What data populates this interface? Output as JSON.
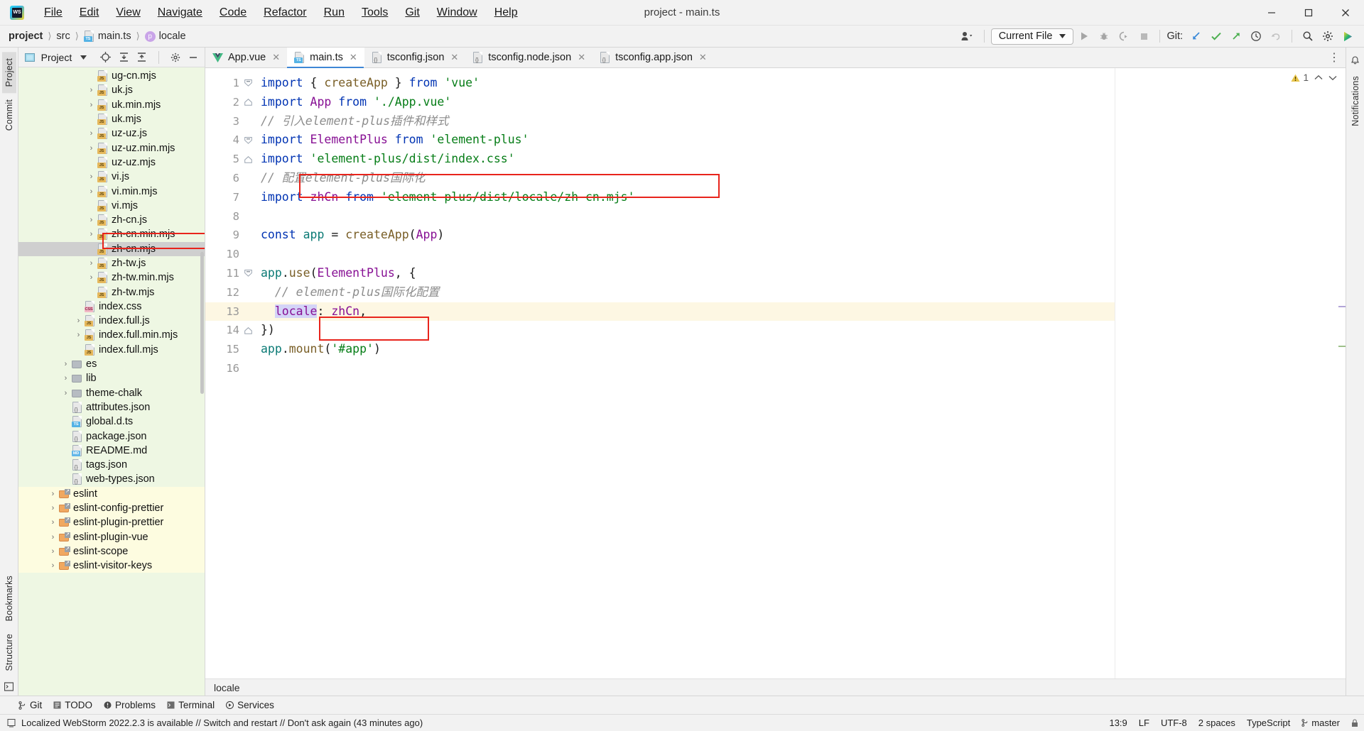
{
  "window": {
    "title": "project - main.ts",
    "app_icon": "webstorm-logo",
    "minimize": "─",
    "maximize": "☐",
    "close": "✕"
  },
  "menubar": [
    {
      "label": "File"
    },
    {
      "label": "Edit"
    },
    {
      "label": "View"
    },
    {
      "label": "Navigate"
    },
    {
      "label": "Code"
    },
    {
      "label": "Refactor"
    },
    {
      "label": "Run"
    },
    {
      "label": "Tools"
    },
    {
      "label": "Git"
    },
    {
      "label": "Window"
    },
    {
      "label": "Help"
    }
  ],
  "navbar": {
    "breadcrumbs": [
      {
        "label": "project",
        "icon": ""
      },
      {
        "label": "src",
        "icon": ""
      },
      {
        "label": "main.ts",
        "icon": "ts-file-icon"
      },
      {
        "label": "locale",
        "icon": "property-icon"
      }
    ],
    "separator": "〉",
    "run_config": "Current File",
    "run_config_caret": "▼",
    "git_label": "Git:",
    "icons": [
      "avatar-dropdown-icon",
      "run-icon",
      "debug-icon",
      "coverage-icon",
      "stop-icon",
      "update-project-icon",
      "commit-icon",
      "push-icon",
      "history-icon",
      "rollback-icon",
      "search-everywhere-icon",
      "settings-icon",
      "ide-assistant-icon"
    ]
  },
  "left_rail": {
    "tabs": [
      {
        "label": "Project",
        "active": true
      },
      {
        "label": "Commit",
        "active": false
      },
      {
        "label": "Bookmarks",
        "active": false
      },
      {
        "label": "Structure",
        "active": false
      }
    ]
  },
  "right_rail": {
    "tabs": [
      {
        "label": "Notifications",
        "active": false
      }
    ]
  },
  "project_panel": {
    "title": "Project",
    "title_caret": "▼",
    "toolbar_icons": [
      "locate-icon",
      "expand-all-icon",
      "collapse-all-icon",
      "settings-icon",
      "hide-icon"
    ],
    "tree": [
      {
        "name": "ug-cn.mjs",
        "icon": "js-file-icon",
        "indent": 5,
        "arrow": "",
        "sel": false,
        "bg": "green"
      },
      {
        "name": "uk.js",
        "icon": "js-file-icon",
        "indent": 5,
        "arrow": "›",
        "sel": false,
        "bg": "green"
      },
      {
        "name": "uk.min.mjs",
        "icon": "js-file-icon",
        "indent": 5,
        "arrow": "›",
        "sel": false,
        "bg": "green"
      },
      {
        "name": "uk.mjs",
        "icon": "js-file-icon",
        "indent": 5,
        "arrow": "",
        "sel": false,
        "bg": "green"
      },
      {
        "name": "uz-uz.js",
        "icon": "js-file-icon",
        "indent": 5,
        "arrow": "›",
        "sel": false,
        "bg": "green"
      },
      {
        "name": "uz-uz.min.mjs",
        "icon": "js-file-icon",
        "indent": 5,
        "arrow": "›",
        "sel": false,
        "bg": "green"
      },
      {
        "name": "uz-uz.mjs",
        "icon": "js-file-icon",
        "indent": 5,
        "arrow": "",
        "sel": false,
        "bg": "green"
      },
      {
        "name": "vi.js",
        "icon": "js-file-icon",
        "indent": 5,
        "arrow": "›",
        "sel": false,
        "bg": "green"
      },
      {
        "name": "vi.min.mjs",
        "icon": "js-file-icon",
        "indent": 5,
        "arrow": "›",
        "sel": false,
        "bg": "green"
      },
      {
        "name": "vi.mjs",
        "icon": "js-file-icon",
        "indent": 5,
        "arrow": "",
        "sel": false,
        "bg": "green"
      },
      {
        "name": "zh-cn.js",
        "icon": "js-file-icon",
        "indent": 5,
        "arrow": "›",
        "sel": false,
        "bg": "green"
      },
      {
        "name": "zh-cn.min.mjs",
        "icon": "js-file-icon",
        "indent": 5,
        "arrow": "›",
        "sel": false,
        "bg": "green"
      },
      {
        "name": "zh-cn.mjs",
        "icon": "js-file-icon",
        "indent": 5,
        "arrow": "",
        "sel": true,
        "bg": "green"
      },
      {
        "name": "zh-tw.js",
        "icon": "js-file-icon",
        "indent": 5,
        "arrow": "›",
        "sel": false,
        "bg": "green"
      },
      {
        "name": "zh-tw.min.mjs",
        "icon": "js-file-icon",
        "indent": 5,
        "arrow": "›",
        "sel": false,
        "bg": "green"
      },
      {
        "name": "zh-tw.mjs",
        "icon": "js-file-icon",
        "indent": 5,
        "arrow": "",
        "sel": false,
        "bg": "green"
      },
      {
        "name": "index.css",
        "icon": "css-file-icon",
        "indent": 4,
        "arrow": "",
        "sel": false,
        "bg": "green"
      },
      {
        "name": "index.full.js",
        "icon": "js-file-icon",
        "indent": 4,
        "arrow": "›",
        "sel": false,
        "bg": "green"
      },
      {
        "name": "index.full.min.mjs",
        "icon": "js-file-icon",
        "indent": 4,
        "arrow": "›",
        "sel": false,
        "bg": "green"
      },
      {
        "name": "index.full.mjs",
        "icon": "js-file-icon",
        "indent": 4,
        "arrow": "",
        "sel": false,
        "bg": "green"
      },
      {
        "name": "es",
        "icon": "folder-icon",
        "indent": 3,
        "arrow": "›",
        "sel": false,
        "bg": "green"
      },
      {
        "name": "lib",
        "icon": "folder-icon",
        "indent": 3,
        "arrow": "›",
        "sel": false,
        "bg": "green"
      },
      {
        "name": "theme-chalk",
        "icon": "folder-icon",
        "indent": 3,
        "arrow": "›",
        "sel": false,
        "bg": "green"
      },
      {
        "name": "attributes.json",
        "icon": "json-file-icon",
        "indent": 3,
        "arrow": "",
        "sel": false,
        "bg": "green"
      },
      {
        "name": "global.d.ts",
        "icon": "ts-file-icon",
        "indent": 3,
        "arrow": "",
        "sel": false,
        "bg": "green"
      },
      {
        "name": "package.json",
        "icon": "json-file-icon",
        "indent": 3,
        "arrow": "",
        "sel": false,
        "bg": "green"
      },
      {
        "name": "README.md",
        "icon": "md-file-icon",
        "indent": 3,
        "arrow": "",
        "sel": false,
        "bg": "green"
      },
      {
        "name": "tags.json",
        "icon": "json-file-icon",
        "indent": 3,
        "arrow": "",
        "sel": false,
        "bg": "green"
      },
      {
        "name": "web-types.json",
        "icon": "json-file-icon",
        "indent": 3,
        "arrow": "",
        "sel": false,
        "bg": "green"
      },
      {
        "name": "eslint",
        "icon": "linked-folder-icon",
        "indent": 2,
        "arrow": "›",
        "sel": false,
        "bg": "yellow"
      },
      {
        "name": "eslint-config-prettier",
        "icon": "linked-folder-icon",
        "indent": 2,
        "arrow": "›",
        "sel": false,
        "bg": "yellow"
      },
      {
        "name": "eslint-plugin-prettier",
        "icon": "linked-folder-icon",
        "indent": 2,
        "arrow": "›",
        "sel": false,
        "bg": "yellow"
      },
      {
        "name": "eslint-plugin-vue",
        "icon": "linked-folder-icon",
        "indent": 2,
        "arrow": "›",
        "sel": false,
        "bg": "yellow"
      },
      {
        "name": "eslint-scope",
        "icon": "linked-folder-icon",
        "indent": 2,
        "arrow": "›",
        "sel": false,
        "bg": "yellow"
      },
      {
        "name": "eslint-visitor-keys",
        "icon": "linked-folder-icon",
        "indent": 2,
        "arrow": "›",
        "sel": false,
        "bg": "yellow"
      }
    ]
  },
  "editor": {
    "tabs": [
      {
        "label": "App.vue",
        "icon": "vue-file-icon",
        "active": false,
        "close": "✕"
      },
      {
        "label": "main.ts",
        "icon": "ts-file-icon",
        "active": true,
        "close": "✕"
      },
      {
        "label": "tsconfig.json",
        "icon": "json-file-icon",
        "active": false,
        "close": "✕"
      },
      {
        "label": "tsconfig.node.json",
        "icon": "json-file-icon",
        "active": false,
        "close": "✕"
      },
      {
        "label": "tsconfig.app.json",
        "icon": "json-file-icon",
        "active": false,
        "close": "✕"
      }
    ],
    "tabbar_more": "⋮",
    "inspection": {
      "warning_count": "1",
      "up": "⌃",
      "down": "⌄"
    },
    "breadcrumb_bottom": "locale",
    "line_numbers": [
      "1",
      "2",
      "3",
      "4",
      "5",
      "6",
      "7",
      "8",
      "9",
      "10",
      "11",
      "12",
      "13",
      "14",
      "15",
      "16"
    ],
    "lines": [
      {
        "n": 1,
        "fold": "minus",
        "text": "import { createApp } from 'vue'"
      },
      {
        "n": 2,
        "fold": "end",
        "text": "import App from './App.vue'"
      },
      {
        "n": 3,
        "fold": "",
        "text": "// 引入element-plus插件和样式"
      },
      {
        "n": 4,
        "fold": "minus",
        "text": "import ElementPlus from 'element-plus'"
      },
      {
        "n": 5,
        "fold": "end",
        "text": "import 'element-plus/dist/index.css'"
      },
      {
        "n": 6,
        "fold": "",
        "text": "// 配置element-plus国际化"
      },
      {
        "n": 7,
        "fold": "",
        "text": "import zhCn from 'element-plus/dist/locale/zh-cn.mjs'"
      },
      {
        "n": 8,
        "fold": "",
        "text": ""
      },
      {
        "n": 9,
        "fold": "",
        "text": "const app = createApp(App)"
      },
      {
        "n": 10,
        "fold": "",
        "text": ""
      },
      {
        "n": 11,
        "fold": "minus",
        "text": "app.use(ElementPlus, {"
      },
      {
        "n": 12,
        "fold": "",
        "text": "  // element-plus国际化配置"
      },
      {
        "n": 13,
        "fold": "",
        "text": "  locale: zhCn,"
      },
      {
        "n": 14,
        "fold": "end",
        "text": "})"
      },
      {
        "n": 15,
        "fold": "",
        "text": "app.mount('#app')"
      },
      {
        "n": 16,
        "fold": "",
        "text": ""
      }
    ]
  },
  "annotations": {
    "color": "#e8241c",
    "boxes": [
      "tree-zh-cn-mjs-highlight",
      "code-line-7-highlight",
      "code-line-13-locale-highlight"
    ]
  },
  "tool_windows": [
    {
      "label": "Git",
      "icon": "git-branch-icon"
    },
    {
      "label": "TODO",
      "icon": "todo-icon"
    },
    {
      "label": "Problems",
      "icon": "problems-icon"
    },
    {
      "label": "Terminal",
      "icon": "terminal-icon"
    },
    {
      "label": "Services",
      "icon": "services-icon"
    }
  ],
  "statusbar": {
    "message_icon": "notification-icon",
    "message": "Localized WebStorm 2022.2.3 is available // Switch and restart // Don't ask again (43 minutes ago)",
    "caret": "13:9",
    "line_sep": "LF",
    "encoding": "UTF-8",
    "indent": "2 spaces",
    "language": "TypeScript",
    "branch": "master",
    "branch_icon": "git-branch-icon",
    "lock_icon": "lock-icon"
  }
}
